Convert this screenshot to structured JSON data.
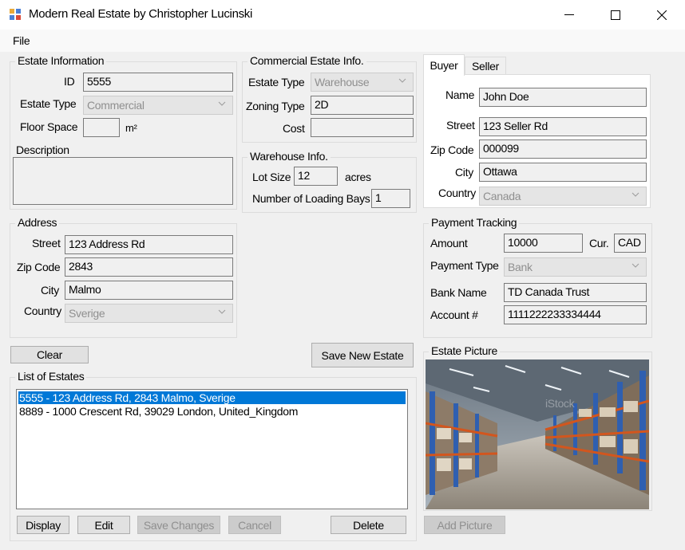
{
  "window": {
    "title": "Modern Real Estate by Christopher Lucinski"
  },
  "menu": {
    "file": "File"
  },
  "estate": {
    "group_title": "Estate Information",
    "id_label": "ID",
    "id_value": "5555",
    "type_label": "Estate Type",
    "type_value": "Commercial",
    "floor_label": "Floor Space",
    "floor_value": "",
    "floor_unit": "m²",
    "desc_label": "Description",
    "desc_value": ""
  },
  "commercial": {
    "group_title": "Commercial Estate Info.",
    "type_label": "Estate Type",
    "type_value": "Warehouse",
    "zoning_label": "Zoning Type",
    "zoning_value": "2D",
    "cost_label": "Cost",
    "cost_value": ""
  },
  "warehouse": {
    "group_title": "Warehouse Info.",
    "lot_label": "Lot Size",
    "lot_value": "12",
    "lot_unit": "acres",
    "bays_label": "Number of Loading Bays",
    "bays_value": "1"
  },
  "tabs": {
    "buyer": "Buyer",
    "seller": "Seller",
    "active": "Buyer"
  },
  "buyer": {
    "name_label": "Name",
    "name_value": "John Doe",
    "street_label": "Street",
    "street_value": "123 Seller Rd",
    "zip_label": "Zip Code",
    "zip_value": "000099",
    "city_label": "City",
    "city_value": "Ottawa",
    "country_label": "Country",
    "country_value": "Canada"
  },
  "address": {
    "group_title": "Address",
    "street_label": "Street",
    "street_value": "123 Address Rd",
    "zip_label": "Zip Code",
    "zip_value": "2843",
    "city_label": "City",
    "city_value": "Malmo",
    "country_label": "Country",
    "country_value": "Sverige"
  },
  "payment": {
    "group_title": "Payment Tracking",
    "amount_label": "Amount",
    "amount_value": "10000",
    "cur_label": "Cur.",
    "cur_value": "CAD",
    "type_label": "Payment Type",
    "type_value": "Bank",
    "bank_label": "Bank Name",
    "bank_value": "TD Canada Trust",
    "account_label": "Account #",
    "account_value": "1111222233334444"
  },
  "buttons": {
    "clear": "Clear",
    "save_new": "Save New Estate",
    "display": "Display",
    "edit": "Edit",
    "save_changes": "Save Changes",
    "cancel": "Cancel",
    "delete": "Delete",
    "add_picture": "Add Picture"
  },
  "list": {
    "group_title": "List of Estates",
    "items": [
      "5555 - 123 Address Rd, 2843 Malmo, Sverige",
      "8889 - 1000 Crescent Rd, 39029 London, United_Kingdom"
    ],
    "selected_index": 0
  },
  "picture": {
    "group_title": "Estate Picture",
    "watermark": "iStock"
  },
  "colors": {
    "selection": "#0078d7",
    "window_bg": "#f0f0f0"
  }
}
